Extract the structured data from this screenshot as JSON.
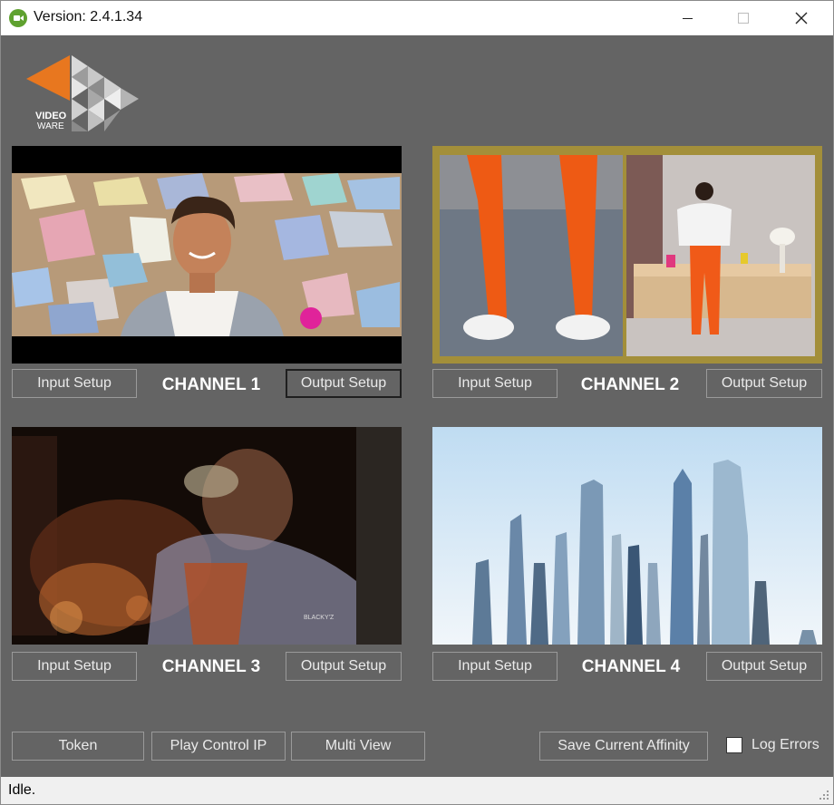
{
  "window": {
    "title": "Version: 2.4.1.34"
  },
  "logo": {
    "line1": "VIDEO",
    "line2": "WARE"
  },
  "channels": [
    {
      "label": "CHANNEL 1",
      "input_label": "Input Setup",
      "output_label": "Output Setup"
    },
    {
      "label": "CHANNEL 2",
      "input_label": "Input Setup",
      "output_label": "Output Setup"
    },
    {
      "label": "CHANNEL 3",
      "input_label": "Input Setup",
      "output_label": "Output Setup"
    },
    {
      "label": "CHANNEL 4",
      "input_label": "Input Setup",
      "output_label": "Output Setup"
    }
  ],
  "footer": {
    "token_label": "Token",
    "play_control_label": "Play Control IP",
    "multi_view_label": "Multi View",
    "save_affinity_label": "Save Current Affinity",
    "log_errors_label": "Log Errors"
  },
  "status": {
    "text": "Idle."
  },
  "colors": {
    "client_bg": "#646464",
    "logo_orange": "#e8771f",
    "ch2_border": "#a38f3a"
  }
}
